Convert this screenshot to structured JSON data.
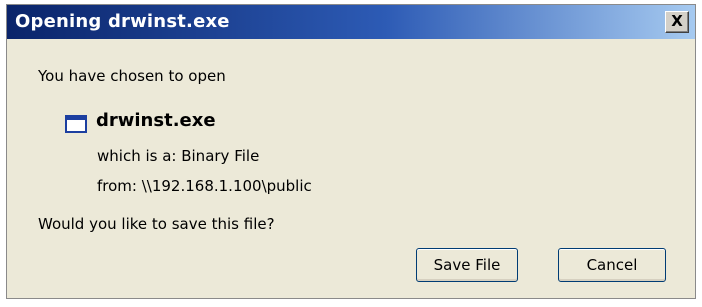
{
  "window": {
    "title": "Opening drwinst.exe",
    "close_label": "X"
  },
  "dialog": {
    "prompt": "You have chosen to open",
    "file_icon": "application-window-icon",
    "file_name": "drwinst.exe",
    "type_line": "which is a:  Binary File",
    "from_line": "from:  \\\\192.168.1.100\\public",
    "question": "Would you like to save this file?"
  },
  "buttons": {
    "save_label": "Save File",
    "cancel_label": "Cancel"
  },
  "colors": {
    "titlebar_start": "#0a246a",
    "titlebar_end": "#a6caf0",
    "dialog_background": "#ece9d8",
    "button_border": "#003c74"
  }
}
